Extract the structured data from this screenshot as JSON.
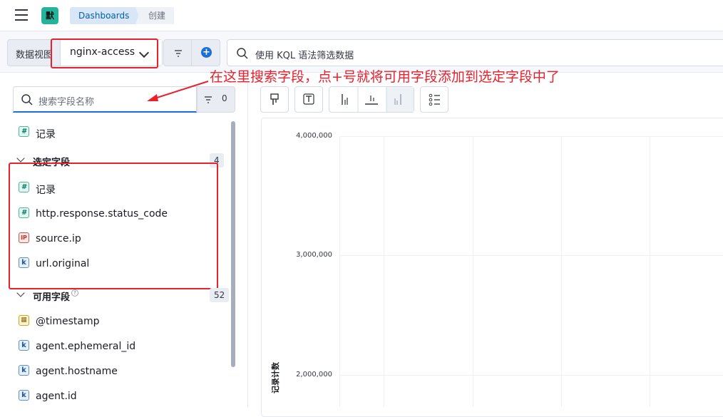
{
  "header": {
    "space_badge": "默",
    "breadcrumbs": [
      "Dashboards",
      "创建"
    ]
  },
  "query_bar": {
    "data_view_label": "数据视图",
    "data_view_value": "nginx-access",
    "kql_placeholder": "使用 KQL 语法筛选数据"
  },
  "annotation": "在这里搜索字段，点+号就将可用字段添加到选定字段中了",
  "sidebar": {
    "search_placeholder": "搜索字段名称",
    "filter_count": "0",
    "top_field": {
      "name": "记录",
      "type": "#"
    },
    "selected_section": {
      "title": "选定字段",
      "count": "4",
      "fields": [
        {
          "name": "记录",
          "type": "#"
        },
        {
          "name": "http.response.status_code",
          "type": "#"
        },
        {
          "name": "source.ip",
          "type": "IP"
        },
        {
          "name": "url.original",
          "type": "k"
        }
      ]
    },
    "available_section": {
      "title": "可用字段",
      "count": "52",
      "fields": [
        {
          "name": "@timestamp",
          "type": "date"
        },
        {
          "name": "agent.ephemeral_id",
          "type": "k"
        },
        {
          "name": "agent.hostname",
          "type": "k"
        },
        {
          "name": "agent.id",
          "type": "k"
        }
      ]
    }
  },
  "chart": {
    "y_label": "记录计数",
    "y_ticks": [
      "4,000,000",
      "3,000,000",
      "2,000,000"
    ]
  },
  "colors": {
    "accent": "#1d6fd8",
    "annotation_red": "#e8212d",
    "space_badge": "#24b39b"
  }
}
